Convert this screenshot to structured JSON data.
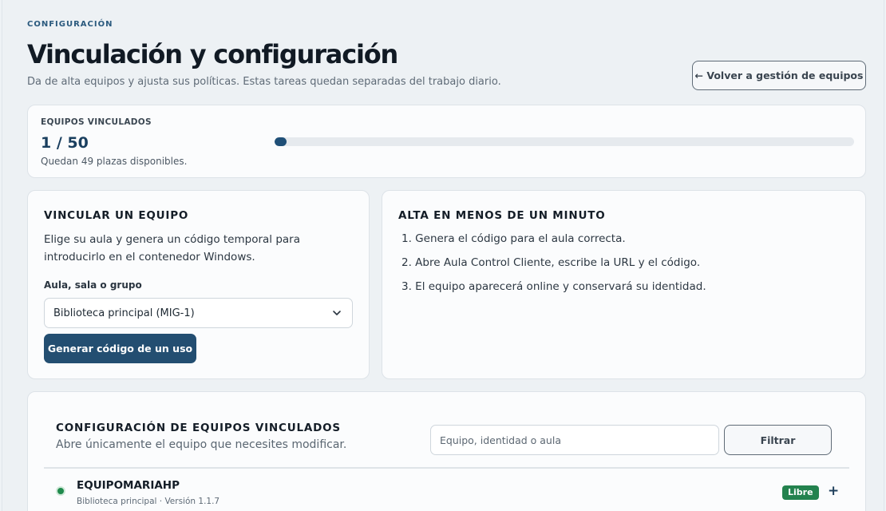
{
  "header": {
    "eyebrow": "CONFIGURACIÓN",
    "title": "Vinculación y configuración",
    "subtitle": "Da de alta equipos y ajusta sus políticas. Estas tareas quedan separadas del trabajo diario.",
    "back_button": "← Volver a gestión de equipos"
  },
  "stats": {
    "label": "EQUIPOS VINCULADOS",
    "value": "1 / 50",
    "note": "Quedan 49 plazas disponibles.",
    "progress_percent": 2
  },
  "link_device": {
    "heading": "VINCULAR UN EQUIPO",
    "description": "Elige su aula y genera un código temporal para introducirlo en el contenedor Windows.",
    "field_label": "Aula, sala o grupo",
    "selected_option": "Biblioteca principal (MIG-1)",
    "generate_button": "Generar código de un uso"
  },
  "quick_setup": {
    "heading": "ALTA EN MENOS DE UN MINUTO",
    "steps": [
      "1. Genera el código para el aula correcta.",
      "2. Abre Aula Control Cliente, escribe la URL y el código.",
      "3. El equipo aparecerá online y conservará su identidad."
    ]
  },
  "config": {
    "heading": "CONFIGURACIÓN DE EQUIPOS VINCULADOS",
    "description": "Abre únicamente el equipo que necesites modificar.",
    "search_placeholder": "Equipo, identidad o aula",
    "filter_button": "Filtrar",
    "devices": [
      {
        "name": "EQUIPOMARIAHP",
        "meta": "Biblioteca principal · Versión 1.1.7",
        "badge": "Libre",
        "status": "online",
        "expand": "+"
      }
    ]
  },
  "colors": {
    "primary": "#234e71",
    "online": "#1f8a4c",
    "badge_free": "#23824e"
  },
  "icons": {
    "select": "chevron-down-icon",
    "status": "status-dot-icon",
    "expand": "plus-icon"
  }
}
